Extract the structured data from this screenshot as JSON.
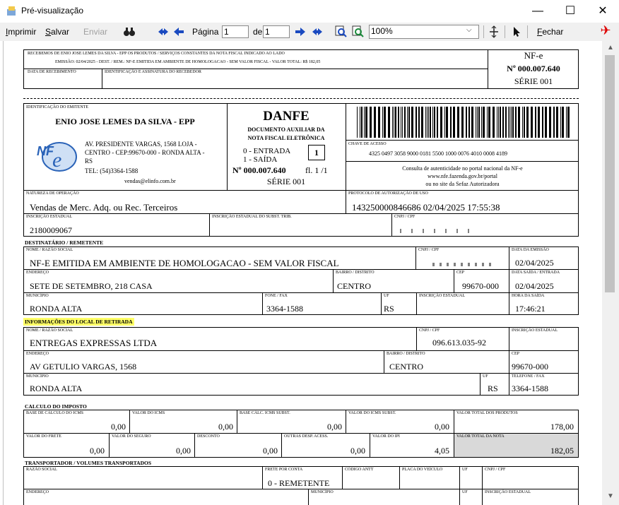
{
  "window": {
    "title": "Pré-visualização",
    "minimize": "—",
    "maximize": "☐",
    "close": "✕"
  },
  "toolbar": {
    "print": "Imprimir",
    "save": "Salvar",
    "send": "Enviar",
    "page_label": "Página",
    "page_current": "1",
    "page_of": "de",
    "page_total": "1",
    "zoom": "100%",
    "close": "Fechar"
  },
  "receipt": {
    "line1": "RECEBEMOS DE ENIO JOSE LEMES DA SILVA - EPP OS PRODUTOS / SERVIÇOS CONSTANTES DA NOTA FISCAL INDICADO AO LADO",
    "line2": "EMISSÃO: 02/04/2025 - DEST. / REM.: NF-E EMITIDA EM AMBIENTE DE HOMOLOGACAO - SEM VALOR FISCAL - VALOR TOTAL: R$ 182,05",
    "date_label": "DATA DE RECEBIMENTO",
    "sign_label": "IDENTIFICAÇÃO E ASSINATURA DO RECEBEDOR",
    "nfe": "NF-e",
    "number": "Nº 000.007.640",
    "series": "SÉRIE 001"
  },
  "issuer": {
    "label": "IDENTIFICAÇÃO DO EMITENTE",
    "name": "ENIO JOSE LEMES DA SILVA - EPP",
    "address1": "AV. PRESIDENTE VARGAS, 1568 LOJA -",
    "address2": "CENTRO - CEP:99670-000 - RONDA ALTA -",
    "address3": "RS",
    "phone": "TEL: (54)3364-1588",
    "email": "vendas@elinfo.com.br",
    "logo_text": "NF"
  },
  "danfe": {
    "title": "DANFE",
    "subtitle1": "DOCUMENTO AUXILIAR DA",
    "subtitle2": "NOTA FISCAL ELETRÔNICA",
    "entry": "0 - ENTRADA",
    "exit": "1 - SAÍDA",
    "type_value": "1",
    "number": "Nº 000.007.640",
    "sheet": "fl. 1 /1",
    "series": "SÉRIE 001"
  },
  "access": {
    "label": "CHAVE DE ACESSO",
    "key": "4325 0497 3058 9000 0181 5500 1000 0076 4010 0008 4189",
    "consult1": "Consulta de autenticidade no portal nacional da NF-e",
    "consult2": "www.nfe.fazenda.gov.br/portal",
    "consult3": "ou no site da Sefaz Autorizadora"
  },
  "nature": {
    "label": "NATUREZA DE OPERAÇÃO",
    "value": "Vendas de Merc. Adq. ou Rec. Terceiros",
    "protocol_label": "PROTOCOLO DE AUTORIZAÇÃO DE USO",
    "protocol_value": "143250000846686 02/04/2025 17:55:38"
  },
  "ie": {
    "label": "INSCRIÇÃO ESTADUAL",
    "value": "2180009067",
    "subst_label": "INSCRIÇÃO ESTADUAL DO SUBST. TRIB.",
    "cnpj_label": "CNPJ / CPF"
  },
  "recipient": {
    "section": "DESTINATÁRIO / REMETENTE",
    "name_label": "NOME / RAZÃO SOCIAL",
    "name": "NF-E EMITIDA EM AMBIENTE DE HOMOLOGACAO - SEM VALOR FISCAL",
    "cnpj_label": "CNPJ / CPF",
    "emission_label": "DATA DA EMISSÃO",
    "emission": "02/04/2025",
    "address_label": "ENDEREÇO",
    "address": "SETE DE SETEMBRO, 218 CASA",
    "district_label": "BAIRRO / DISTRITO",
    "district": "CENTRO",
    "cep_label": "CEP",
    "cep": "99670-000",
    "exit_label": "DATA SAÍDA / ENTRADA",
    "exit": "02/04/2025",
    "city_label": "MUNICÍPIO",
    "city": "RONDA ALTA",
    "phone_label": "FONE / FAX",
    "phone": "3364-1588",
    "uf_label": "UF",
    "uf": "RS",
    "ie_label": "INSCRIÇÃO ESTADUAL",
    "time_label": "HORA DA SAÍDA",
    "time": "17:46:21"
  },
  "pickup": {
    "section": "INFORMAÇÕES DO LOCAL DE RETIRADA",
    "name_label": "NOME / RAZÃO SOCIAL",
    "name": "ENTREGAS EXPRESSAS LTDA",
    "cnpj_label": "CNPJ / CPF",
    "cnpj": "096.613.035-92",
    "ie_label": "INSCRIÇÃO ESTADUAL",
    "address_label": "ENDEREÇO",
    "address": "AV GETULIO VARGAS, 1568",
    "district_label": "BAIRRO / DISTRITO",
    "district": "CENTRO",
    "cep_label": "CEP",
    "cep": "99670-000",
    "city_label": "MUNICÍPIO",
    "city": "RONDA ALTA",
    "uf_label": "UF",
    "uf": "RS",
    "phone_label": "TELEFONE / FAX",
    "phone": "3364-1588"
  },
  "tax": {
    "section": "CALCULO DO IMPOSTO",
    "base_icms_label": "BASE DE CÁLCULO DO ICMS",
    "base_icms": "0,00",
    "icms_label": "VALOR DO ICMS",
    "icms": "0,00",
    "base_st_label": "BASE CÁLC. ICMS SUBST.",
    "base_st": "0,00",
    "icms_st_label": "VALOR DO ICMS SUBST.",
    "icms_st": "0,00",
    "products_label": "VALOR TOTAL DOS PRODUTOS",
    "products": "178,00",
    "freight_label": "VALOR DO FRETE",
    "freight": "0,00",
    "insurance_label": "VALOR DO SEGURO",
    "insurance": "0,00",
    "discount_label": "DESCONTO",
    "discount": "0,00",
    "other_label": "OUTRAS DESP. ACESS.",
    "other": "0,00",
    "ipi_label": "VALOR DO IPI",
    "ipi": "4,05",
    "total_label": "VALOR TOTAL DA NOTA",
    "total": "182,05"
  },
  "transport": {
    "section": "TRANSPORTADOR / VOLUMES TRANSPORTADOS",
    "name_label": "RAZÃO SOCIAL",
    "freight_label": "FRETE POR CONTA",
    "freight": "0 - REMETENTE",
    "antt_label": "CÓDIGO ANTT",
    "plate_label": "PLACA DO VEÍCULO",
    "uf_label": "UF",
    "cnpj_label": "CNPJ / CPF",
    "address_label": "ENDEREÇO",
    "city_label": "MUNICÍPIO",
    "uf2_label": "UF",
    "ie_label": "INSCRIÇÃO ESTADUAL"
  },
  "colors": {
    "highlight": "#ffff66",
    "nfe_logo": "#2a63b8"
  }
}
